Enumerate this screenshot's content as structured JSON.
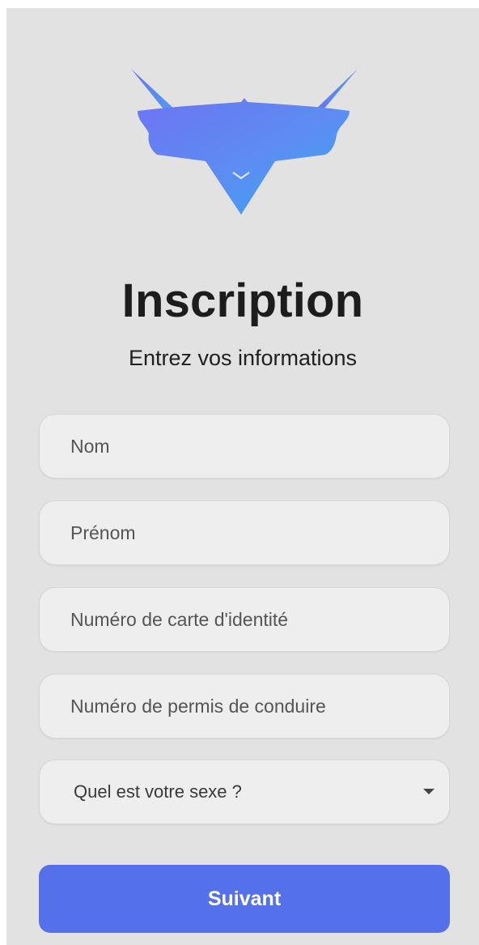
{
  "app": {
    "logo_icon": "bull-head-logo-icon"
  },
  "header": {
    "title": "Inscription",
    "subtitle": "Entrez vos informations"
  },
  "form": {
    "last_name_placeholder": "Nom",
    "first_name_placeholder": "Prénom",
    "id_card_placeholder": "Numéro de carte d'identité",
    "license_placeholder": "Numéro de permis de conduire",
    "sex_select": {
      "selected": "Quel est votre sexe ?",
      "icon": "caret-down-icon"
    }
  },
  "actions": {
    "next_label": "Suivant"
  },
  "colors": {
    "background": "#e2e2e2",
    "field_bg": "#eeeeee",
    "primary_button": "#5470ea",
    "logo_gradient_start": "#6a7cf3",
    "logo_gradient_end": "#39a8f1"
  }
}
